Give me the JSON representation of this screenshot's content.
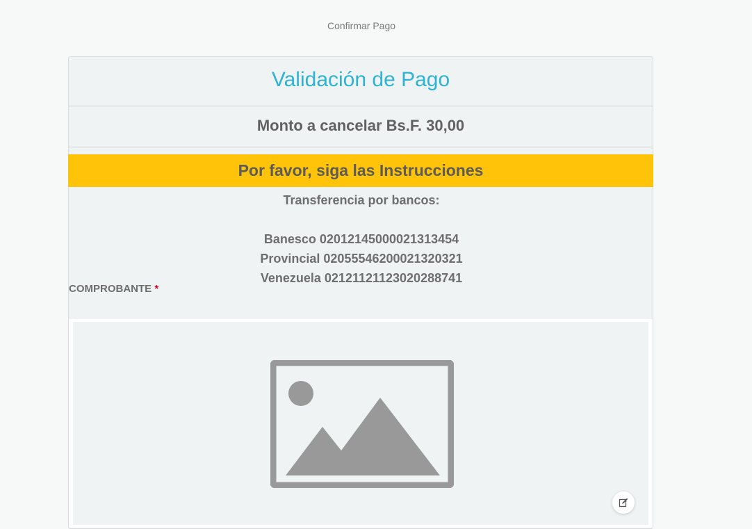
{
  "breadcrumb": "Confirmar Pago",
  "card": {
    "title": "Validación de Pago",
    "amount": "Monto a cancelar Bs.F. 30,00",
    "instructions_banner": "Por favor, siga las Instrucciones",
    "instructions": {
      "heading": "Transferencia por bancos:",
      "banks": [
        "Banesco 02012145000021313454",
        "Provincial 02055546200021320321",
        "Venezuela 02121121123020288741"
      ]
    },
    "comprobante": {
      "label": "COMPROBANTE",
      "required_mark": "*"
    },
    "upload": {
      "placeholder_icon": "image-placeholder-icon",
      "edit_icon": "edit-icon"
    }
  },
  "colors": {
    "title": "#2fb3d3",
    "banner": "#ffc40a",
    "required": "#d0021b"
  }
}
